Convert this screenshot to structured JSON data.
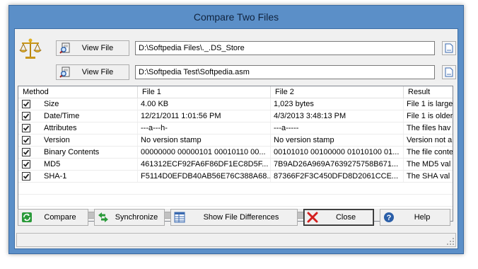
{
  "window": {
    "title": "Compare Two Files"
  },
  "file1": {
    "button_label": "View File",
    "path": "D:\\Softpedia Files\\._.DS_Store"
  },
  "file2": {
    "button_label": "View File",
    "path": "D:\\Softpedia Test\\Softpedia.asm"
  },
  "list": {
    "columns": [
      "Method",
      "File 1",
      "File 2",
      "Result"
    ],
    "rows": [
      {
        "checked": true,
        "method": "Size",
        "file1": "4.00 KB",
        "file2": "1,023 bytes",
        "result": "File 1 is large"
      },
      {
        "checked": true,
        "method": "Date/Time",
        "file1": "12/21/2011 1:01:56 PM",
        "file2": "4/3/2013 3:48:13 PM",
        "result": "File 1 is older"
      },
      {
        "checked": true,
        "method": "Attributes",
        "file1": "---a---h-",
        "file2": "---a-----",
        "result": "The files hav"
      },
      {
        "checked": true,
        "method": "Version",
        "file1": "No version stamp",
        "file2": "No version stamp",
        "result": "Version not a"
      },
      {
        "checked": true,
        "method": "Binary Contents",
        "file1": "00000000 00000101 00010110 00...",
        "file2": "00101010 00100000 01010100 01...",
        "result": "The file conte"
      },
      {
        "checked": true,
        "method": "MD5",
        "file1": "461312ECF92FA6F86DF1EC8D5F...",
        "file2": "7B9AD26A969A7639275758B671...",
        "result": "The MD5 val"
      },
      {
        "checked": true,
        "method": "SHA-1",
        "file1": "F5114D0EFDB40AB56E76C388A68...",
        "file2": "87366F2F3C450DFD8D2061CCE...",
        "result": "The SHA val"
      }
    ]
  },
  "actions": {
    "compare": "Compare",
    "synchronize": "Synchronize",
    "show_differences": "Show File Differences",
    "close": "Close",
    "help": "Help"
  },
  "icons": {
    "logo": "scales-of-justice-icon",
    "view_file": "magnifier-document-icon",
    "browse": "document-browse-icon",
    "compare": "refresh-icon",
    "synchronize": "sync-arrows-icon",
    "show_differences": "grid-differences-icon",
    "close": "red-x-icon",
    "help": "question-mark-icon"
  }
}
